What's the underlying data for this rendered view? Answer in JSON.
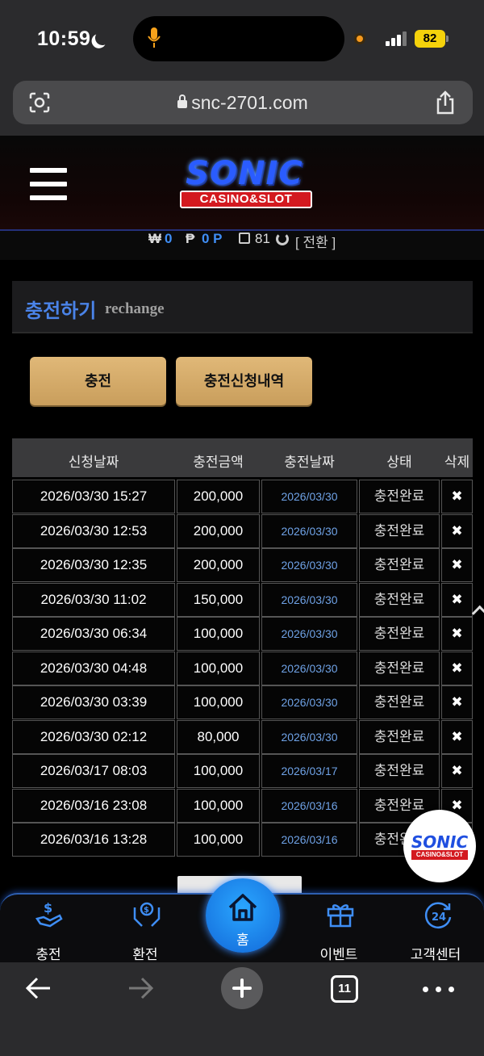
{
  "status_bar": {
    "time": "10:59",
    "battery": "82"
  },
  "browser": {
    "url": "snc-2701.com",
    "tab_count": "11"
  },
  "header": {
    "logo_main": "SONIC",
    "logo_sub": "CASINO&SLOT"
  },
  "balance": {
    "won_symbol": "₩",
    "won_value": "0",
    "point_symbol": "₱",
    "point_value": "0 P",
    "coupon_value": "81",
    "switch_label": "[ 전환 ]"
  },
  "section": {
    "title_ko": "충전하기",
    "title_en": "rechange"
  },
  "buttons": {
    "deposit": "충전",
    "history": "충전신청내역"
  },
  "table": {
    "headers": [
      "신청날짜",
      "충전금액",
      "충전날짜",
      "상태",
      "삭제"
    ],
    "rows": [
      [
        "2026/03/30 15:27",
        "200,000",
        "2026/03/30",
        "충전완료"
      ],
      [
        "2026/03/30 12:53",
        "200,000",
        "2026/03/30",
        "충전완료"
      ],
      [
        "2026/03/30 12:35",
        "200,000",
        "2026/03/30",
        "충전완료"
      ],
      [
        "2026/03/30 11:02",
        "150,000",
        "2026/03/30",
        "충전완료"
      ],
      [
        "2026/03/30 06:34",
        "100,000",
        "2026/03/30",
        "충전완료"
      ],
      [
        "2026/03/30 04:48",
        "100,000",
        "2026/03/30",
        "충전완료"
      ],
      [
        "2026/03/30 03:39",
        "100,000",
        "2026/03/30",
        "충전완료"
      ],
      [
        "2026/03/30 02:12",
        "80,000",
        "2026/03/30",
        "충전완료"
      ],
      [
        "2026/03/17 08:03",
        "100,000",
        "2026/03/17",
        "충전완료"
      ],
      [
        "2026/03/16 23:08",
        "100,000",
        "2026/03/16",
        "충전완료"
      ],
      [
        "2026/03/16 13:28",
        "100,000",
        "2026/03/16",
        "충전완료"
      ]
    ],
    "delete_glyph": "✖"
  },
  "float_badge": {
    "main": "SONIC",
    "sub": "CASINO&SLOT"
  },
  "bottom_nav": {
    "deposit": "충전",
    "withdraw": "환전",
    "home": "홈",
    "event": "이벤트",
    "support": "고객센터"
  },
  "colors": {
    "accent_blue": "#3f8ef5",
    "gold": "#d9b070",
    "brand_red": "#d3191f"
  }
}
